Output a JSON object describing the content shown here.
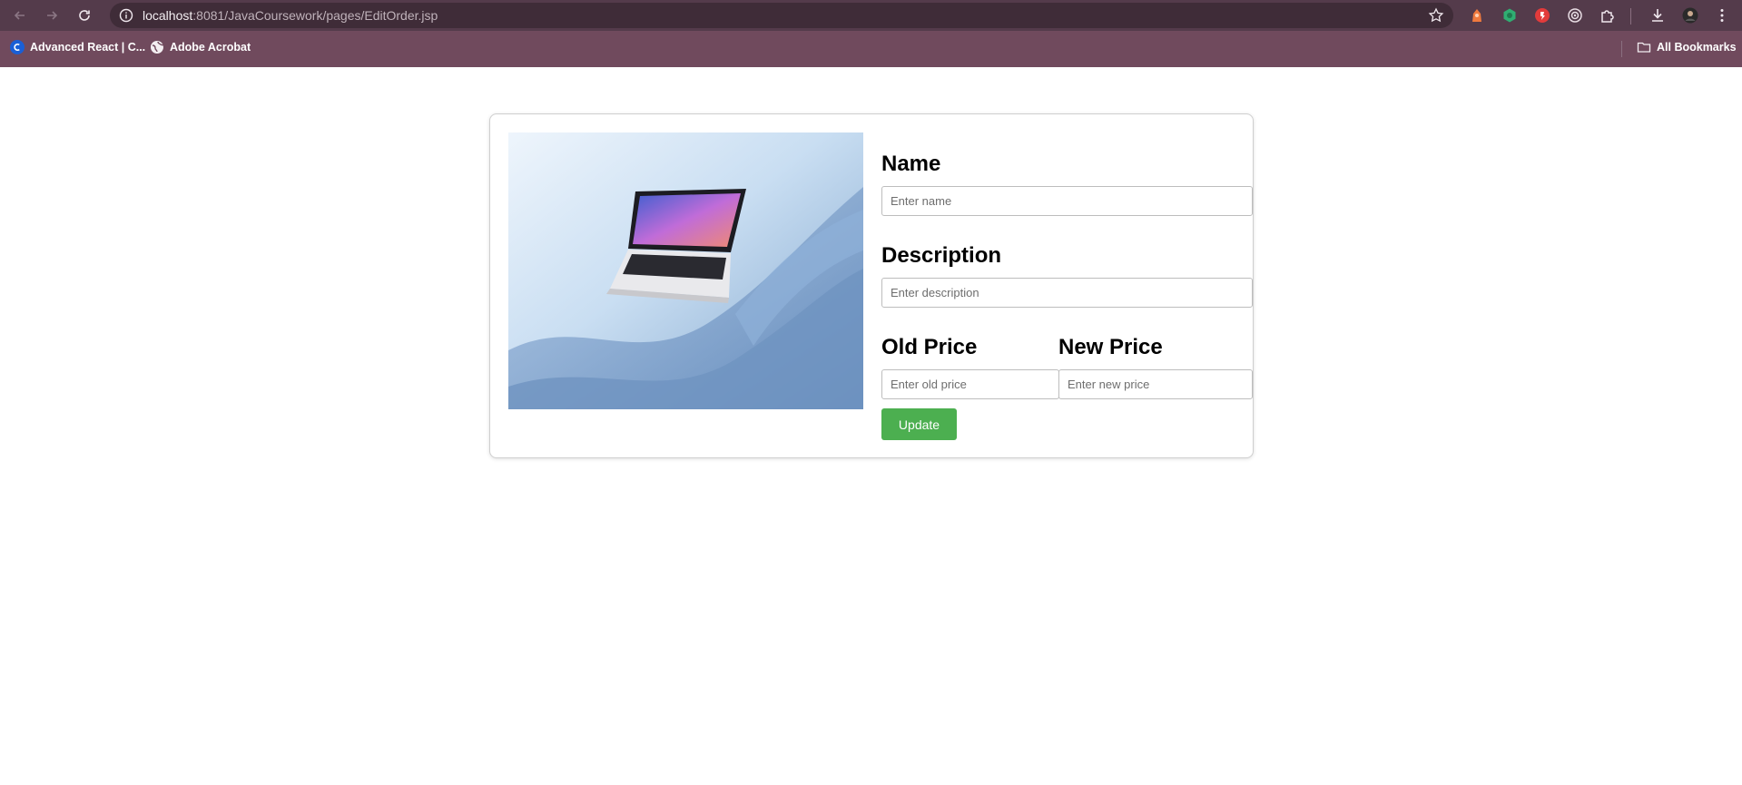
{
  "browser": {
    "url_host": "localhost",
    "url_path": ":8081/JavaCoursework/pages/EditOrder.jsp",
    "bookmarks": [
      {
        "label": "Advanced React | C...",
        "icon": "c-logo-icon"
      },
      {
        "label": "Adobe Acrobat",
        "icon": "globe-icon"
      }
    ],
    "all_bookmarks_label": "All Bookmarks"
  },
  "form": {
    "name_label": "Name",
    "name_placeholder": "Enter name",
    "description_label": "Description",
    "description_placeholder": "Enter description",
    "old_price_label": "Old Price",
    "old_price_placeholder": "Enter old price",
    "new_price_label": "New Price",
    "new_price_placeholder": "Enter new price",
    "update_label": "Update"
  },
  "colors": {
    "titlebar": "#543b4b",
    "bookmarks_bar": "#704a5d",
    "update_button": "#4caf50"
  }
}
